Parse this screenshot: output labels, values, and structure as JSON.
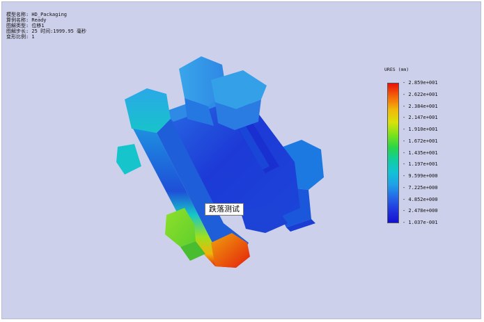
{
  "info": {
    "lines": [
      "模型名称: HD_Packaging",
      "算例名称: Ready",
      "图解类型:  位移1",
      "图解步长: 25   时间:1999.95 毫秒",
      "变形比例: 1"
    ]
  },
  "legend": {
    "title": "URES (mm)",
    "ticks": [
      "2.859e+001",
      "2.622e+001",
      "2.384e+001",
      "2.147e+001",
      "1.910e+001",
      "1.672e+001",
      "1.435e+001",
      "1.197e+001",
      "9.599e+000",
      "7.225e+000",
      "4.852e+000",
      "2.478e+000",
      "1.037e-001"
    ]
  },
  "tooltip": {
    "label": "跌落测试"
  },
  "colors": {
    "background": "#cdd0ea",
    "max": "#e8120b",
    "min": "#1410d0"
  }
}
